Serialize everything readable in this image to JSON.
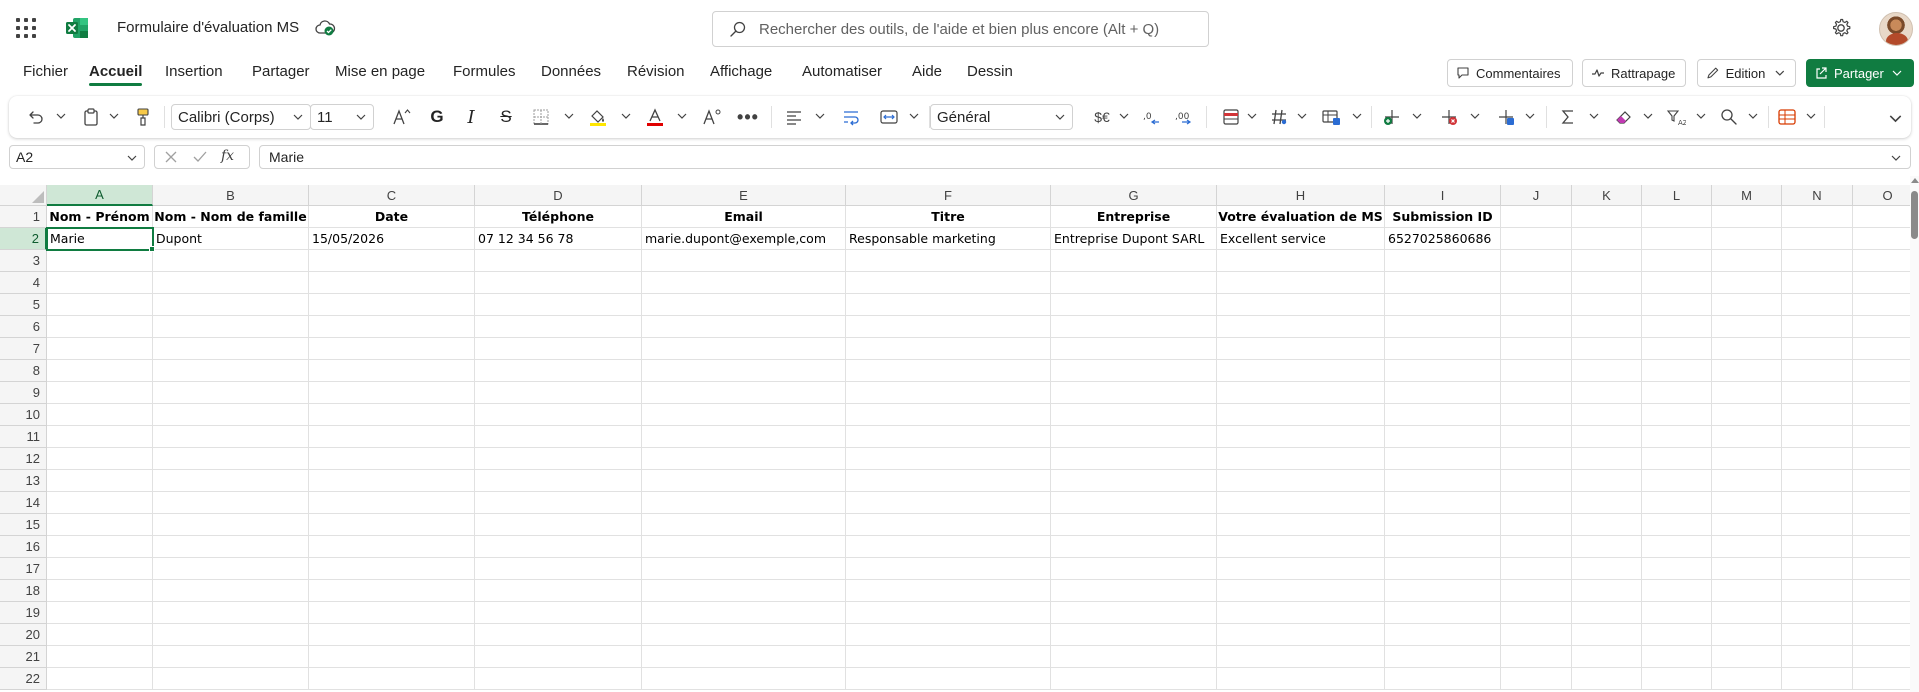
{
  "app": {
    "doc_title": "Formulaire d'évaluation MS"
  },
  "search": {
    "placeholder": "Rechercher des outils, de l'aide et bien plus encore (Alt + Q)"
  },
  "menu": {
    "items": [
      "Fichier",
      "Accueil",
      "Insertion",
      "Partager",
      "Mise en page",
      "Formules",
      "Données",
      "Révision",
      "Affichage",
      "Automatiser",
      "Aide",
      "Dessin"
    ],
    "active": "Accueil"
  },
  "actions": {
    "comments": "Commentaires",
    "catchup": "Rattrapage",
    "edition": "Edition",
    "share": "Partager"
  },
  "ribbon": {
    "font_name": "Calibri (Corps)",
    "font_size": "11",
    "number_format": "Général",
    "bold_glyph": "G",
    "italic_glyph": "I",
    "strike_glyph": "S",
    "currency_glyph": "$€",
    "font_color": "#e00000",
    "fill_color": "#ffe600"
  },
  "formula_bar": {
    "name_box": "A2",
    "fx_glyph": "fx",
    "content": "Marie"
  },
  "sheet": {
    "columns": [
      "A",
      "B",
      "C",
      "D",
      "E",
      "F",
      "G",
      "H",
      "I",
      "J",
      "K",
      "L",
      "M",
      "N",
      "O"
    ],
    "selected_column": "A",
    "selected_row": "2",
    "rows": [
      "1",
      "2",
      "3",
      "4",
      "5",
      "6",
      "7",
      "8",
      "9",
      "10",
      "11",
      "12",
      "13",
      "14",
      "15",
      "16",
      "17",
      "18",
      "19",
      "20",
      "21",
      "22"
    ],
    "header_row": [
      "Nom - Prénom",
      "Nom - Nom de famille",
      "Date",
      "Téléphone",
      "Email",
      "Titre",
      "Entreprise",
      "Votre évaluation de MS",
      "Submission ID",
      "",
      "",
      "",
      "",
      "",
      ""
    ],
    "data_rows": [
      [
        "Marie",
        "Dupont",
        "15/05/2026",
        "07 12 34 56 78",
        "marie.dupont@exemple,com",
        "Responsable marketing",
        "Entreprise Dupont SARL",
        "Excellent service",
        "6527025860686",
        "",
        "",
        "",
        "",
        "",
        ""
      ]
    ]
  },
  "theme": {
    "accent": "#107c41"
  }
}
